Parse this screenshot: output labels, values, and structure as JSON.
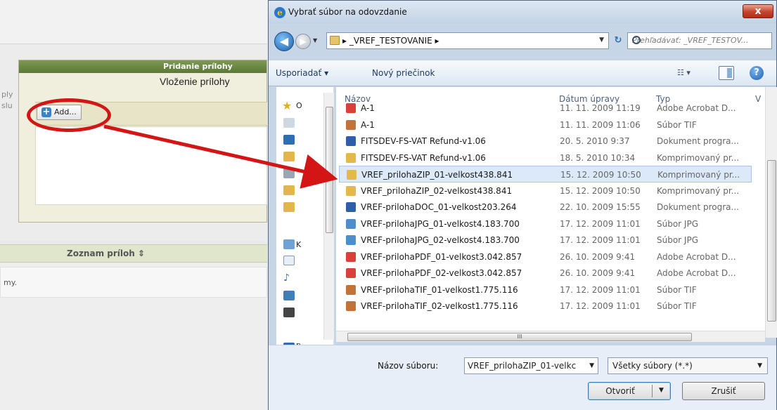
{
  "background": {
    "edge_labels": [
      "ply",
      "slu"
    ],
    "attach_panel": {
      "header": "Pridanie prílohy",
      "subtitle": "Vloženie prílohy",
      "add_button": "Add..."
    },
    "list_header": "Zoznam príloh ⇕",
    "notice": "my."
  },
  "dialog": {
    "title": "Vybrať súbor na odovzdanie",
    "close_label": "x",
    "address_crumb": "▸  _VREF_TESTOVANIE  ▸",
    "search_placeholder": "Prehľadávať: _VREF_TESTOV...",
    "toolbar": {
      "organize": "Usporiadať ▾",
      "new_folder": "Nový priečinok",
      "views": "☷ ▾"
    },
    "navpane": {
      "favorites_label": "O",
      "k_label": "K",
      "p_label": "p"
    },
    "columns": {
      "name": "Názov",
      "date": "Dátum úpravy",
      "type": "Typ",
      "extra": "V"
    },
    "files": [
      {
        "name": "A-1",
        "date": "11. 11. 2009 11:19",
        "type": "Adobe Acrobat D...",
        "icon": "pdf"
      },
      {
        "name": "A-1",
        "date": "11. 11. 2009 11:06",
        "type": "Súbor TIF",
        "icon": "tif"
      },
      {
        "name": "FITSDEV-FS-VAT Refund-v1.06",
        "date": "20. 5. 2010 9:37",
        "type": "Dokument progra...",
        "icon": "doc"
      },
      {
        "name": "FITSDEV-FS-VAT Refund-v1.06",
        "date": "18. 5. 2010 10:34",
        "type": "Komprimovaný pr...",
        "icon": "zip"
      },
      {
        "name": "VREF_prilohaZIP_01-velkost438.841",
        "date": "15. 12. 2009 10:50",
        "type": "Komprimovaný pr...",
        "icon": "zip",
        "selected": true
      },
      {
        "name": "VREF_prilohaZIP_02-velkost438.841",
        "date": "15. 12. 2009 10:50",
        "type": "Komprimovaný pr...",
        "icon": "zip"
      },
      {
        "name": "VREF-prilohaDOC_01-velkost203.264",
        "date": "22. 10. 2009 15:55",
        "type": "Dokument progra...",
        "icon": "doc"
      },
      {
        "name": "VREF-prilohaJPG_01-velkost4.183.700",
        "date": "17. 12. 2009 11:01",
        "type": "Súbor JPG",
        "icon": "jpg"
      },
      {
        "name": "VREF-prilohaJPG_02-velkost4.183.700",
        "date": "17. 12. 2009 11:01",
        "type": "Súbor JPG",
        "icon": "jpg"
      },
      {
        "name": "VREF-prilohaPDF_01-velkost3.042.857",
        "date": "26. 10. 2009 9:41",
        "type": "Adobe Acrobat D...",
        "icon": "pdf"
      },
      {
        "name": "VREF-prilohaPDF_02-velkost3.042.857",
        "date": "26. 10. 2009 9:41",
        "type": "Adobe Acrobat D...",
        "icon": "pdf"
      },
      {
        "name": "VREF-prilohaTIF_01-velkost1.775.116",
        "date": "17. 12. 2009 11:01",
        "type": "Súbor TIF",
        "icon": "tif"
      },
      {
        "name": "VREF-prilohaTIF_02-velkost1.775.116",
        "date": "17. 12. 2009 11:01",
        "type": "Súbor TIF",
        "icon": "tif"
      }
    ],
    "hscroll_grip": "III",
    "filename_label": "Názov súboru:",
    "filename_value": "VREF_prilohaZIP_01-velkc",
    "filter_value": "Všetky súbory (*.*)",
    "open_label": "Otvoriť",
    "cancel_label": "Zrušiť"
  },
  "colors": {
    "annotation_red": "#d41515",
    "selection": "#dbe9f9",
    "panel_header_green": "#6b8844"
  },
  "icons": {
    "pdf": "pdf-file-icon",
    "tif": "image-file-icon",
    "doc": "word-document-icon",
    "zip": "zip-folder-icon",
    "jpg": "photo-file-icon"
  }
}
